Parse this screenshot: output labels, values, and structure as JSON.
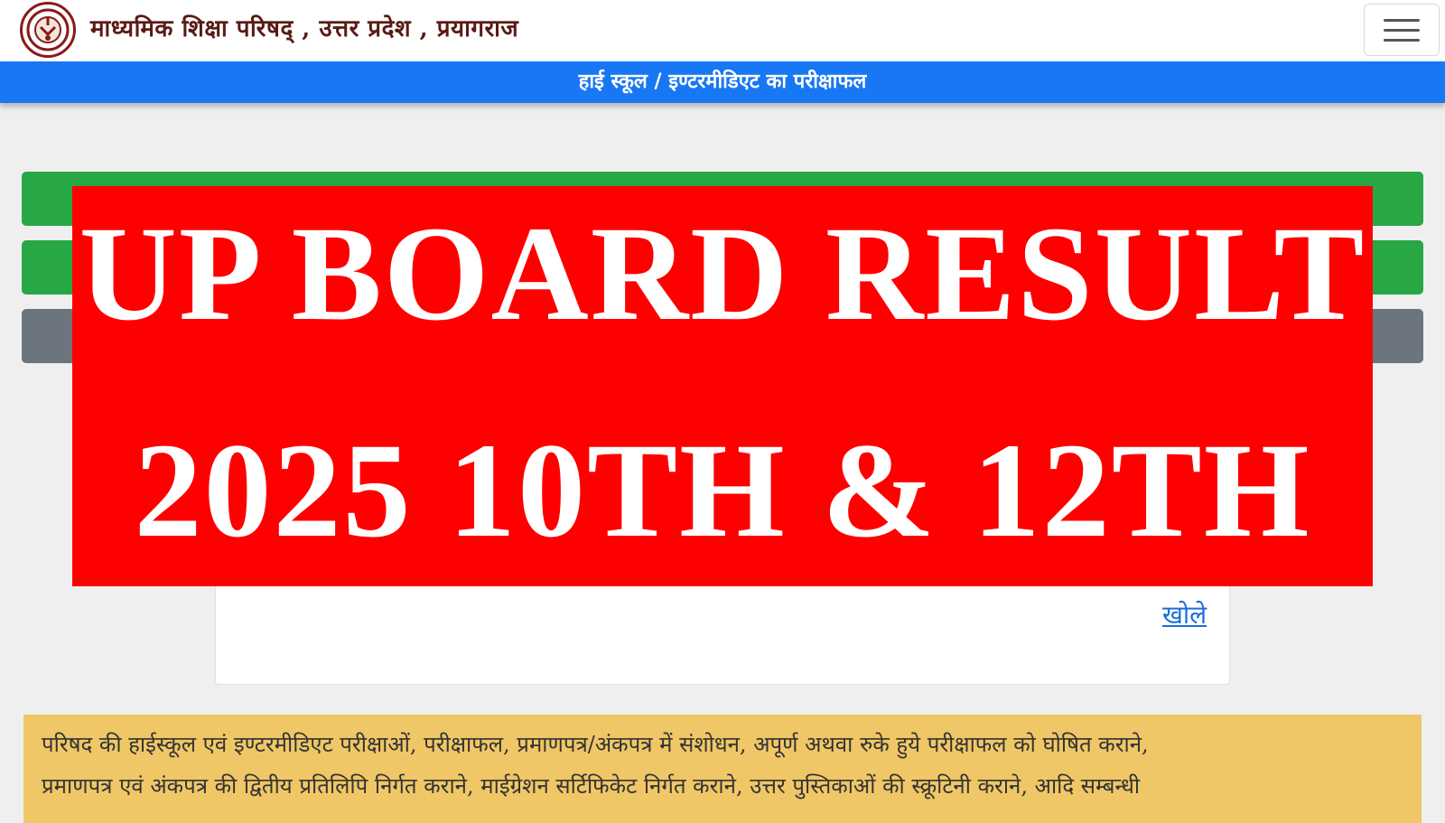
{
  "header": {
    "logo_icon": "up-govt-emblem-icon",
    "site_title": "माध्यमिक शिक्षा परिषद् , उत्तर प्रदेश , प्रयागराज",
    "menu_icon": "hamburger-menu-icon"
  },
  "nav": {
    "title": "हाई स्कूल / इण्टरमीडिएट का परीक्षाफल",
    "color": "#1877f2"
  },
  "buttons": {
    "colors": [
      "#28a745",
      "#28a745",
      "#6c757d"
    ]
  },
  "card": {
    "link_label": "खोले"
  },
  "notice": {
    "line1": "परिषद की हाईस्कूल एवं इण्टरमीडिएट परीक्षाओं, परीक्षाफल, प्रमाणपत्र/अंकपत्र में संशोधन, अपूर्ण अथवा रुके हुये परीक्षाफल को घोषित कराने,",
    "line2": "प्रमाणपत्र एवं अंकपत्र की द्वितीय प्रतिलिपि निर्गत कराने, माईग्रेशन सर्टिफिकेट निर्गत कराने, उत्तर पुस्तिकाओं की स्क्रूटिनी कराने, आदि सम्बन्धी"
  },
  "banner": {
    "line1": "UP BOARD RESULT",
    "line2": "2025 10TH & 12TH",
    "color": "#fe0000"
  }
}
